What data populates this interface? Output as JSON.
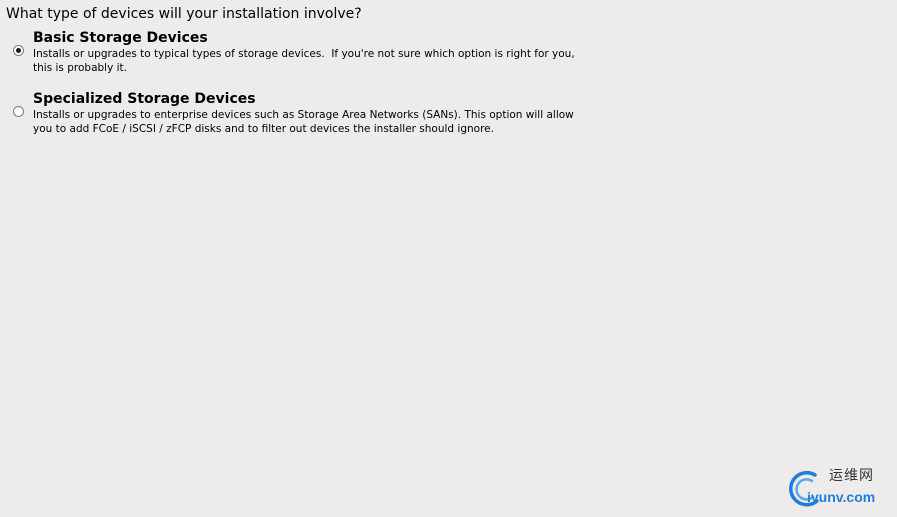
{
  "question": "What type of devices will your installation involve?",
  "options": [
    {
      "title": "Basic Storage Devices",
      "description_line1": "Installs or upgrades to typical types of storage devices.  If you're not sure which option is right for you,",
      "description_line2": "this is probably it.",
      "selected": true
    },
    {
      "title": "Specialized Storage Devices",
      "description_line1": "Installs or upgrades to enterprise devices such as Storage Area Networks (SANs). This option will allow",
      "description_line2": "you to add FCoE / iSCSI / zFCP disks and to filter out devices the installer should ignore.",
      "selected": false
    }
  ],
  "watermark": {
    "cn_text": "运维网",
    "url_text": "iyunv.com",
    "icon": "iyunv-logo-icon",
    "brand_color": "#1f7fd8"
  }
}
